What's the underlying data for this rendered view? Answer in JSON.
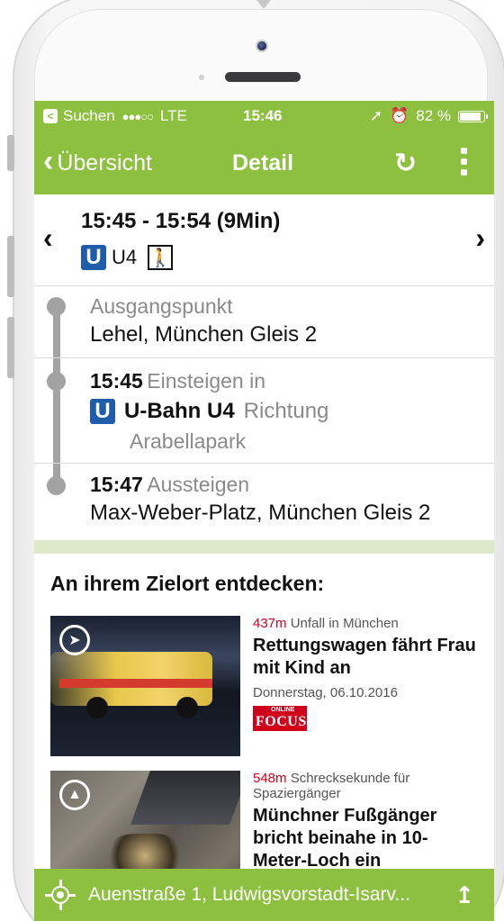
{
  "statusbar": {
    "back_app": "Suchen",
    "signal": "●●●○○",
    "network": "LTE",
    "time": "15:46",
    "battery": "82 %",
    "battery_level": 0.82
  },
  "navbar": {
    "back_label": "Übersicht",
    "title": "Detail"
  },
  "summary": {
    "time_range": "15:45 - 15:54 (9Min)",
    "line": "U4"
  },
  "stops": [
    {
      "label": "Ausgangspunkt",
      "place": "Lehel, München Gleis 2"
    },
    {
      "time": "15:45",
      "action": "Einsteigen in",
      "line_name": "U-Bahn U4",
      "direction_label": "Richtung",
      "destination": "Arabellapark"
    },
    {
      "time": "15:47",
      "action": "Aussteigen",
      "place": "Max-Weber-Platz, München Gleis 2"
    }
  ],
  "discover": {
    "title": "An ihrem Zielort entdecken:",
    "articles": [
      {
        "distance": "437m",
        "category": "Unfall in München",
        "title": "Rettungswagen fährt Frau mit Kind an",
        "date": "Donnerstag, 06.10.2016",
        "source": "FOCUS",
        "source_tag": "ONLINE"
      },
      {
        "distance": "548m",
        "category": "Schrecksekunde für Spaziergänger",
        "title": "Münchner Fußgänger bricht beinahe in 10-Meter-Loch ein"
      }
    ]
  },
  "bottombar": {
    "address": "Auenstraße 1, Ludwigsvorstadt-Isarv..."
  },
  "colors": {
    "accent": "#8dc03f",
    "ubahn": "#1f5ca9",
    "distance": "#d0021b"
  }
}
